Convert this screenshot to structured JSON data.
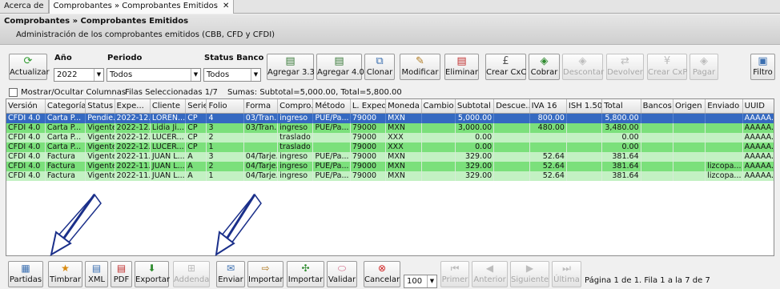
{
  "tabs": [
    {
      "label": "Acerca de"
    },
    {
      "label": "Comprobantes » Comprobantes Emitidos",
      "close": "✕"
    }
  ],
  "header": {
    "title": "Comprobantes » Comprobantes Emitidos",
    "subtitle": "Administración de los comprobantes emitidos (CBB, CFD y CFDI)"
  },
  "filters": {
    "anio_label": "Año",
    "anio_value": "2022",
    "periodo_label": "Periodo",
    "periodo_value": "Todos",
    "status_label": "Status Banco",
    "status_value": "Todos"
  },
  "toolbar": {
    "actualizar": "Actualizar",
    "agregar33": "Agregar 3.3",
    "agregar40": "Agregar 4.0",
    "clonar": "Clonar",
    "modificar": "Modificar",
    "eliminar": "Eliminar",
    "crear_cxc": "Crear CxC",
    "cobrar": "Cobrar",
    "descontar": "Descontar",
    "devolver": "Devolver",
    "crear_cxp": "Crear CxP",
    "pagar": "Pagar",
    "filtro": "Filtro"
  },
  "infobar": {
    "mostrar": "Mostrar/Ocultar Columnas",
    "filas": "Filas Seleccionadas 1/7",
    "sumas": "Sumas:  Subtotal=5,000.00, Total=5,800.00"
  },
  "columns": [
    "Versión",
    "Categoría",
    "Status",
    "Expe...",
    "Cliente",
    "Serie",
    "Folio",
    "Forma",
    "Compro...",
    "Método",
    "L. Exped...",
    "Moneda",
    "Cambio",
    "Subtotal",
    "Descue...",
    "IVA 16",
    "ISH 1.50",
    "Total",
    "Bancos",
    "Origen",
    "Enviado",
    "UUID"
  ],
  "rows": [
    {
      "style": "blue",
      "cells": [
        "CFDI 4.0",
        "Carta P...",
        "Pendie...",
        "2022-12...",
        "LOREN...",
        "CP",
        "4",
        "03/Tran...",
        "ingreso",
        "PUE/Pa...",
        "79000",
        "MXN",
        "",
        "5,000.00",
        "",
        "800.00",
        "",
        "5,800.00",
        "",
        "",
        "",
        "AAAAA..."
      ]
    },
    {
      "style": "green",
      "cells": [
        "CFDI 4.0",
        "Carta P...",
        "Vigente",
        "2022-12...",
        "Lidia Ji...",
        "CP",
        "3",
        "03/Tran...",
        "ingreso",
        "PUE/Pa...",
        "79000",
        "MXN",
        "",
        "3,000.00",
        "",
        "480.00",
        "",
        "3,480.00",
        "",
        "",
        "",
        "AAAAA..."
      ]
    },
    {
      "style": "lgreen",
      "cells": [
        "CFDI 4.0",
        "Carta P...",
        "Vigente",
        "2022-12...",
        "LUCER...",
        "CP",
        "2",
        "",
        "traslado",
        "",
        "79000",
        "XXX",
        "",
        "0.00",
        "",
        "",
        "",
        "0.00",
        "",
        "",
        "",
        "AAAAA..."
      ]
    },
    {
      "style": "green",
      "cells": [
        "CFDI 4.0",
        "Carta P...",
        "Vigente",
        "2022-12...",
        "LUCER...",
        "CP",
        "1",
        "",
        "traslado",
        "",
        "79000",
        "XXX",
        "",
        "0.00",
        "",
        "",
        "",
        "0.00",
        "",
        "",
        "",
        "AAAAA..."
      ]
    },
    {
      "style": "lgreen",
      "cells": [
        "CFDI 4.0",
        "Factura",
        "Vigente",
        "2022-11...",
        "JUAN L...",
        "A",
        "3",
        "04/Tarje...",
        "ingreso",
        "PUE/Pa...",
        "79000",
        "MXN",
        "",
        "329.00",
        "",
        "52.64",
        "",
        "381.64",
        "",
        "",
        "",
        "AAAAA..."
      ]
    },
    {
      "style": "green",
      "cells": [
        "CFDI 4.0",
        "Factura",
        "Vigente",
        "2022-11...",
        "JUAN L...",
        "A",
        "2",
        "04/Tarje...",
        "ingreso",
        "PUE/Pa...",
        "79000",
        "MXN",
        "",
        "329.00",
        "",
        "52.64",
        "",
        "381.64",
        "",
        "",
        "lizcopa...",
        "AAAAA..."
      ]
    },
    {
      "style": "lgreen",
      "cells": [
        "CFDI 4.0",
        "Factura",
        "Vigente",
        "2022-11...",
        "JUAN L...",
        "A",
        "1",
        "04/Tarje...",
        "ingreso",
        "PUE/Pa...",
        "79000",
        "MXN",
        "",
        "329.00",
        "",
        "52.64",
        "",
        "381.64",
        "",
        "",
        "lizcopa...",
        "AAAAA..."
      ]
    }
  ],
  "bottom": {
    "partidas": "Partidas",
    "timbrar": "Timbrar",
    "xml": "XML",
    "pdf": "PDF",
    "exportar": "Exportar",
    "addenda": "Addenda",
    "enviar": "Enviar",
    "importar1": "Importar",
    "importar2": "Importar",
    "validar": "Validar",
    "cancelar": "Cancelar",
    "page_size": "100",
    "primer": "Primer",
    "anterior": "Anterior",
    "siguiente": "Siguiente",
    "ultima": "Última",
    "page_info": "Página 1 de 1. Fila 1 a la 7 de 7"
  }
}
